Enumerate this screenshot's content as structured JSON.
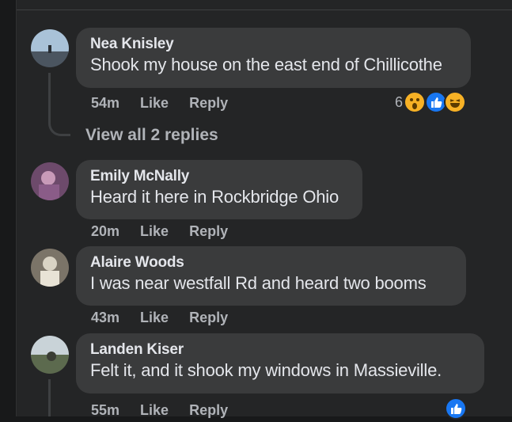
{
  "comments": [
    {
      "name": "Nea Knisley",
      "text": "Shook my house on the east end of Chillicothe",
      "time": "54m",
      "like": "Like",
      "reply": "Reply",
      "reaction_count": "6"
    },
    {
      "name": "Emily McNally",
      "text": "Heard it here in Rockbridge Ohio",
      "time": "20m",
      "like": "Like",
      "reply": "Reply"
    },
    {
      "name": "Alaire Woods",
      "text": "I was near westfall Rd and heard two booms",
      "time": "43m",
      "like": "Like",
      "reply": "Reply"
    },
    {
      "name": "Landen Kiser",
      "text": "Felt it, and it shook my windows in Massieville.",
      "time": "55m",
      "like": "Like",
      "reply": "Reply"
    }
  ],
  "view_replies": "View all 2 replies",
  "icons": {
    "wow": "wow-reaction-icon",
    "like": "like-reaction-icon",
    "haha": "haha-reaction-icon"
  },
  "colors": {
    "background": "#242526",
    "bubble": "#3a3b3c",
    "text": "#e4e6eb",
    "meta": "#b0b3b8",
    "like_blue": "#1877f2"
  }
}
